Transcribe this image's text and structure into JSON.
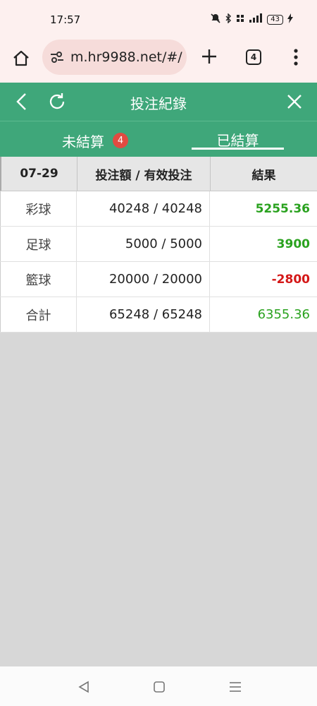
{
  "status": {
    "time": "17:57",
    "battery": "43"
  },
  "browser": {
    "url": "m.hr9988.net/#/(",
    "tab_count": "4"
  },
  "header": {
    "title": "投注紀錄"
  },
  "tabs": {
    "unsettled_label": "未結算",
    "unsettled_count": "4",
    "settled_label": "已結算"
  },
  "table": {
    "columns": [
      "07-29",
      "投注額 / 有效投注",
      "結果"
    ],
    "rows": [
      {
        "type": "彩球",
        "amount": "40248 / 40248",
        "result": "5255.36",
        "sign": "pos"
      },
      {
        "type": "足球",
        "amount": "5000 / 5000",
        "result": "3900",
        "sign": "pos"
      },
      {
        "type": "籃球",
        "amount": "20000 / 20000",
        "result": "-2800",
        "sign": "neg"
      },
      {
        "type": "合計",
        "amount": "65248 / 65248",
        "result": "6355.36",
        "sign": "total"
      }
    ]
  },
  "colors": {
    "header_green": "#3fa77a",
    "positive": "#2aa21f",
    "negative": "#d41818",
    "badge": "#e24b41"
  }
}
